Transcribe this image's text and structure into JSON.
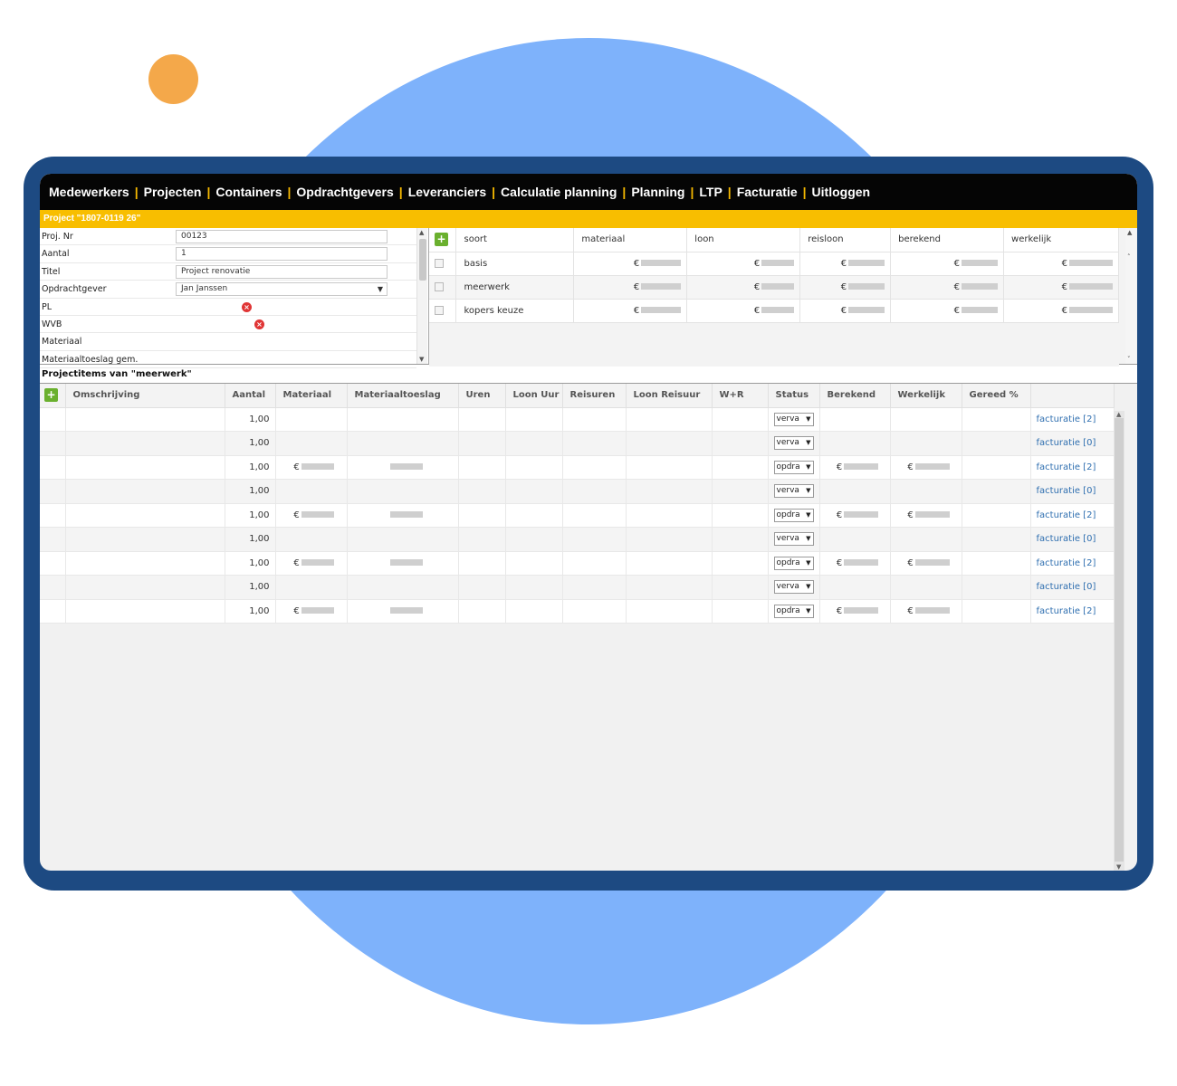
{
  "nav": {
    "items": [
      "Medewerkers",
      "Projecten",
      "Containers",
      "Opdrachtgevers",
      "Leveranciers",
      "Calculatie planning",
      "Planning",
      "LTP",
      "Facturatie",
      "Uitloggen"
    ]
  },
  "project": {
    "title": "Project \"1807-0119 26\"",
    "fields": [
      {
        "label": "Proj. Nr",
        "value": "00123",
        "type": "input"
      },
      {
        "label": "Aantal",
        "value": "1",
        "type": "input"
      },
      {
        "label": "Titel",
        "value": "Project renovatie",
        "type": "input"
      },
      {
        "label": "Opdrachtgever",
        "value": "Jan Janssen",
        "type": "select"
      },
      {
        "label": "PL",
        "value": "",
        "type": "clear"
      },
      {
        "label": "WVB",
        "value": "",
        "type": "clear"
      },
      {
        "label": "Materiaal",
        "value": "",
        "type": "text"
      },
      {
        "label": "Materiaaltoeslag gem.",
        "value": "",
        "type": "text"
      }
    ]
  },
  "types_table": {
    "headers": [
      "soort",
      "materiaal",
      "loon",
      "reisloon",
      "berekend",
      "werkelijk"
    ],
    "rows": [
      {
        "soort": "basis"
      },
      {
        "soort": "meerwerk"
      },
      {
        "soort": "kopers keuze"
      }
    ],
    "currency_symbol": "€"
  },
  "items_section": {
    "title": "Projectitems van \"meerwerk\"",
    "headers": [
      "Omschrijving",
      "Aantal",
      "Materiaal",
      "Materiaaltoeslag",
      "Uren",
      "Loon Uur",
      "Reisuren",
      "Loon Reisuur",
      "W+R",
      "Status",
      "Berekend",
      "Werkelijk",
      "Gereed %"
    ],
    "rows": [
      {
        "aantal": "1,00",
        "status": "verva",
        "has_values": false,
        "link": "facturatie [2]"
      },
      {
        "aantal": "1,00",
        "status": "verva",
        "has_values": false,
        "link": "facturatie [0]"
      },
      {
        "aantal": "1,00",
        "status": "opdra",
        "has_values": true,
        "link": "facturatie [2]"
      },
      {
        "aantal": "1,00",
        "status": "verva",
        "has_values": false,
        "link": "facturatie [0]"
      },
      {
        "aantal": "1,00",
        "status": "opdra",
        "has_values": true,
        "link": "facturatie [2]"
      },
      {
        "aantal": "1,00",
        "status": "verva",
        "has_values": false,
        "link": "facturatie [0]"
      },
      {
        "aantal": "1,00",
        "status": "opdra",
        "has_values": true,
        "link": "facturatie [2]"
      },
      {
        "aantal": "1,00",
        "status": "verva",
        "has_values": false,
        "link": "facturatie [0]"
      },
      {
        "aantal": "1,00",
        "status": "opdra",
        "has_values": true,
        "link": "facturatie [2]"
      }
    ]
  },
  "colors": {
    "nav_bg": "#050505",
    "nav_separator": "#f5b800",
    "titlebar": "#f8be00",
    "add_button": "#6ab02e",
    "clear_icon": "#e03535",
    "link": "#2f6fb0",
    "frame": "#1d4a82",
    "backdrop_circle": "#7eb2fb",
    "accent_dot": "#f4a84a"
  }
}
